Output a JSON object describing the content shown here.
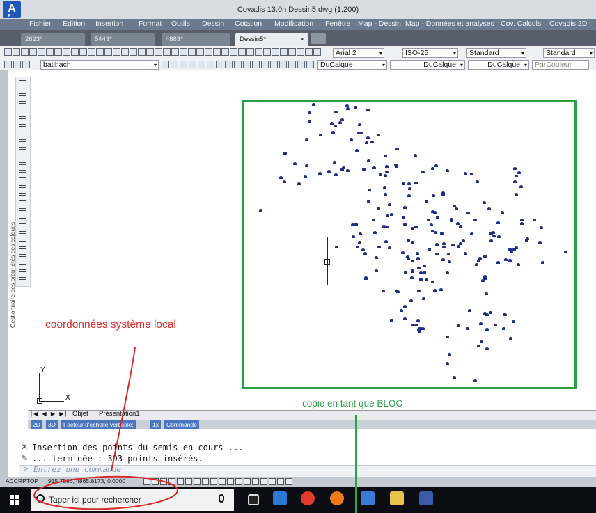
{
  "window": {
    "title": "Covadis 13.0h   Dessin5.dwg (1:200)"
  },
  "menu": [
    "Fichier",
    "Edition",
    "Insertion",
    "Format",
    "Outils",
    "Dessin",
    "Cotation",
    "Modification",
    "Fenêtre",
    "Map - Dessin",
    "Map - Données et analyses",
    "Cov. Calculs",
    "Covadis 2D"
  ],
  "file_tabs": [
    {
      "label": "2623*",
      "active": false
    },
    {
      "label": "5443*",
      "active": false
    },
    {
      "label": "4883*",
      "active": false
    },
    {
      "label": "Dessin5*",
      "active": true,
      "close": "×"
    }
  ],
  "toolbar_styles": {
    "text_font": "Arial 2",
    "dim_style": "ISO-25",
    "table_style": "Standard",
    "multileader_style": "Standard"
  },
  "toolbar_layers": {
    "layer": "batihach",
    "color": "DuCalque",
    "linetype": "DuCalque",
    "lineweight": "DuCalque",
    "plotstyle": "ParCouleur"
  },
  "side_panel_label": "Gestionnaire des propriétés des calques",
  "annotations": {
    "local_coords": "coordonnées système local",
    "bloc_copy": "copie en tant que BLOC"
  },
  "ucs": {
    "x_label": "X",
    "y_label": "Y"
  },
  "layout_tabs": {
    "nav": "|◀ ◀ ▶ ▶|",
    "model": "Objet",
    "layout1": "Présentation1"
  },
  "status_strip": {
    "t2d": "2D",
    "t3d": "3D",
    "vscale": "Facteur d'échelle verticale:",
    "scale_val": "1x",
    "cmd": "Commande"
  },
  "command": {
    "line1": "Insertion des points du semis en cours ...",
    "line2": "  ... terminée : 393 points insérés.",
    "prompt": ">",
    "placeholder": "Entrez une commande"
  },
  "status_bar": {
    "mode": "ACCRPTOP",
    "coords": "915.7596, 4865.8173, 0.0000"
  },
  "taskbar": {
    "search_placeholder": "Taper ici pour rechercher"
  },
  "colors": {
    "annot_red": "#e32b2b",
    "annot_green": "#2aa043",
    "points": "#1b2f8a"
  }
}
